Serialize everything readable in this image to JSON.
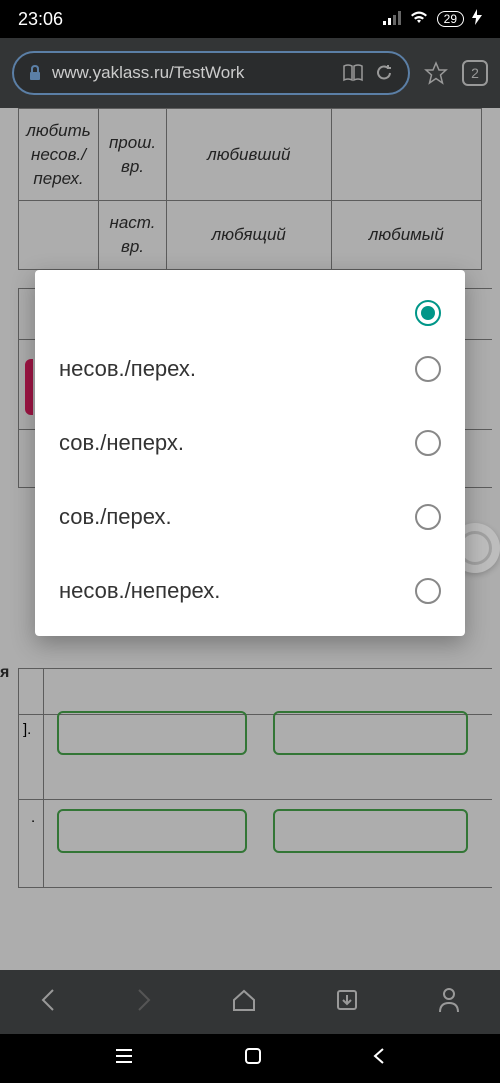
{
  "status": {
    "time": "23:06",
    "battery": "29"
  },
  "browser": {
    "url": "www.yaklass.ru/TestWork",
    "tab_count": "2"
  },
  "top_table": {
    "r0": {
      "verb": "любить",
      "aspect": "несов./",
      "trans": "перех.",
      "tense1": "прош.",
      "tense2": "вр.",
      "participle_act": "любивший",
      "participle_pass": ""
    },
    "r1": {
      "tense1": "наст.",
      "tense2": "вр.",
      "participle_act": "любящий",
      "participle_pass": "любимый"
    }
  },
  "modal": {
    "options": [
      {
        "label": ""
      },
      {
        "label": "несов./перех."
      },
      {
        "label": "сов./неперх."
      },
      {
        "label": "сов./перех."
      },
      {
        "label": "несов./неперех."
      }
    ]
  },
  "bg_labels": {
    "ya": "я",
    "bracket": "]."
  }
}
